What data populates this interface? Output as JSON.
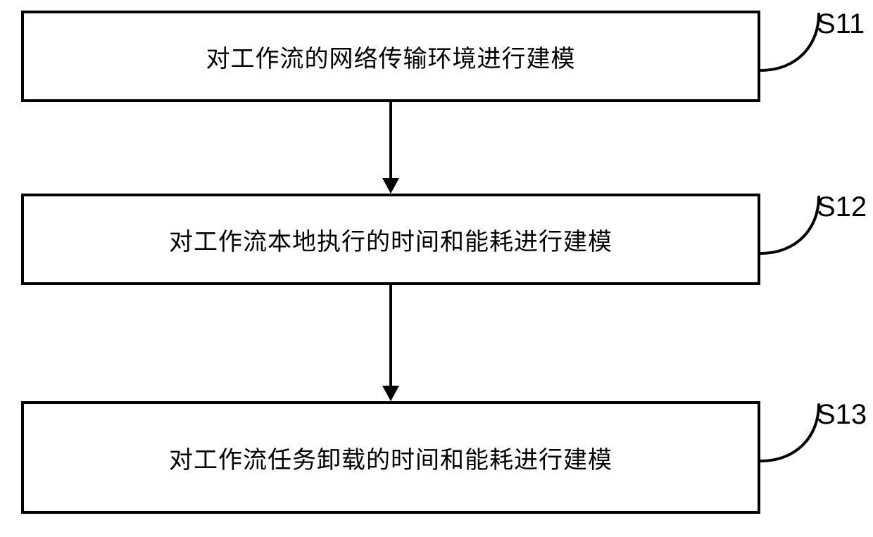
{
  "steps": [
    {
      "id": "S11",
      "text": "对工作流的网络传输环境进行建模"
    },
    {
      "id": "S12",
      "text": "对工作流本地执行的时间和能耗进行建模"
    },
    {
      "id": "S13",
      "text": "对工作流任务卸载的时间和能耗进行建模"
    }
  ],
  "chart_data": {
    "type": "flowchart",
    "nodes": [
      {
        "id": "S11",
        "label": "对工作流的网络传输环境进行建模"
      },
      {
        "id": "S12",
        "label": "对工作流本地执行的时间和能耗进行建模"
      },
      {
        "id": "S13",
        "label": "对工作流任务卸载的时间和能耗进行建模"
      }
    ],
    "edges": [
      {
        "from": "S11",
        "to": "S12"
      },
      {
        "from": "S12",
        "to": "S13"
      }
    ]
  }
}
